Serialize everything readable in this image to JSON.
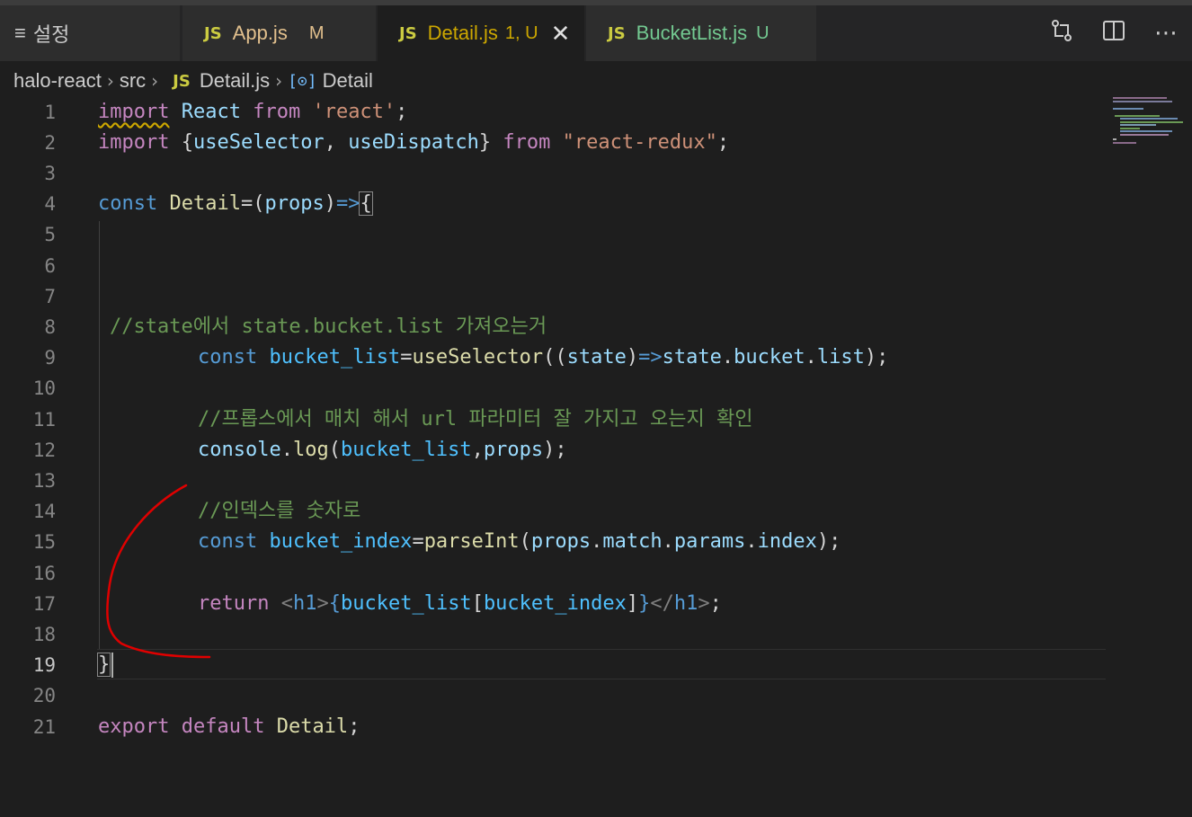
{
  "tabs": {
    "settings": "설정",
    "app": {
      "icon": "JS",
      "name": "App.js",
      "badge": "M"
    },
    "detail": {
      "icon": "JS",
      "name": "Detail.js",
      "badge": "1, U"
    },
    "bucket": {
      "icon": "JS",
      "name": "BucketList.js",
      "badge": "U"
    }
  },
  "breadcrumb": {
    "root": "halo-react",
    "folder": "src",
    "file_icon": "JS",
    "file": "Detail.js",
    "symbol": "Detail"
  },
  "line_numbers": [
    "1",
    "2",
    "3",
    "4",
    "5",
    "6",
    "7",
    "8",
    "9",
    "10",
    "11",
    "12",
    "13",
    "14",
    "15",
    "16",
    "17",
    "18",
    "19",
    "20",
    "21"
  ],
  "code": {
    "l1": [
      "import",
      "React",
      "from",
      "'react'",
      ";"
    ],
    "l2": [
      "import",
      "{",
      "useSelector",
      ",",
      "useDispatch",
      "}",
      "from",
      "\"react-redux\"",
      ";"
    ],
    "l4": [
      "const",
      "Detail",
      "=(",
      "props",
      ")",
      "=>",
      "{"
    ],
    "l8": "//state에서 state.bucket.list 가져오는거",
    "l9": [
      "const",
      "bucket_list",
      "=",
      "useSelector",
      "((",
      "state",
      ")",
      "=>",
      "state",
      ".",
      "bucket",
      ".",
      "list",
      ");"
    ],
    "l11": "//프롭스에서 매치 해서 url 파라미터 잘 가지고 오는지 확인",
    "l12": [
      "console",
      ".",
      "log",
      "(",
      "bucket_list",
      ",",
      "props",
      ");"
    ],
    "l14": "//인덱스를 숫자로",
    "l15": [
      "const",
      "bucket_index",
      "=",
      "parseInt",
      "(",
      "props",
      ".",
      "match",
      ".",
      "params",
      ".",
      "index",
      ");"
    ],
    "l17": [
      "return",
      "<",
      "h1",
      ">",
      "{",
      "bucket_list",
      "[",
      "bucket_index",
      "]",
      "}",
      "</",
      "h1",
      ">",
      ";"
    ],
    "l19": "}",
    "l21": [
      "export",
      "default",
      "Detail",
      ";"
    ]
  },
  "icons": {
    "menu": "menu-icon",
    "close": "close-icon",
    "compare": "compare-changes-icon",
    "split": "split-editor-icon",
    "more": "more-actions-icon"
  },
  "colors": {
    "background": "#1e1e1e",
    "annotation": "#e00000"
  }
}
